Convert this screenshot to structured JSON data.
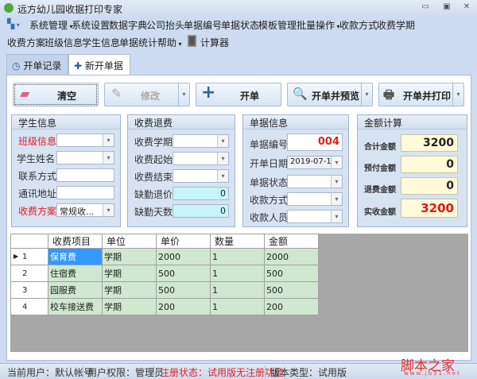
{
  "window": {
    "title": "远方幼儿园收据打印专家",
    "minimize": "▭",
    "restore": "▣",
    "close": "✕"
  },
  "menu": {
    "row1": [
      "系统管理",
      "系统设置",
      "数据字典",
      "公司抬头",
      "单据编号",
      "单据状态",
      "模板管理",
      "批量操作",
      "收款方式",
      "收费学期"
    ],
    "row2": [
      "收费方案",
      "班级信息",
      "学生信息",
      "单据统计",
      "帮助",
      "计算器"
    ]
  },
  "tabs": [
    {
      "label": "开单记录",
      "icon": "history-icon"
    },
    {
      "label": "新开单据",
      "icon": "plus-icon",
      "active": true
    }
  ],
  "toolbar": {
    "clear": "清空",
    "edit": "修改",
    "open": "开单",
    "open_preview": "开单并预览",
    "open_print": "开单并打印"
  },
  "student": {
    "title": "学生信息",
    "class_label": "班级信息",
    "class_value": "",
    "name_label": "学生姓名",
    "name_value": "",
    "contact_label": "联系方式",
    "contact_value": "",
    "address_label": "通讯地址",
    "address_value": "",
    "plan_label": "收费方案",
    "plan_value": "常规收..."
  },
  "fees": {
    "title": "收费退费",
    "term_label": "收费学期",
    "start_label": "收费起始",
    "end_label": "收费结束",
    "refund_price_label": "缺勤退价",
    "refund_price": "0",
    "absent_days_label": "缺勤天数",
    "absent_days": "0"
  },
  "receipt": {
    "title": "单据信息",
    "number_label": "单据编号",
    "number": "004",
    "date_label": "开单日期",
    "date": "2019-07-10",
    "status_label": "单据状态",
    "payment_label": "收款方式",
    "payee_label": "收款人员"
  },
  "amount": {
    "title": "金额计算",
    "total_label": "合计金额",
    "total": "3200",
    "prepaid_label": "预付金额",
    "prepaid": "0",
    "refund_label": "退费金额",
    "refund": "0",
    "received_label": "实收金额",
    "received": "3200"
  },
  "grid": {
    "columns": [
      "收费项目",
      "单位",
      "单价",
      "数量",
      "金额"
    ],
    "rows": [
      [
        "保育费",
        "学期",
        "2000",
        "1",
        "2000"
      ],
      [
        "住宿费",
        "学期",
        "500",
        "1",
        "500"
      ],
      [
        "园服费",
        "学期",
        "500",
        "1",
        "500"
      ],
      [
        "校车接送费",
        "学期",
        "200",
        "1",
        "200"
      ]
    ],
    "row_numbers": [
      "1",
      "2",
      "3",
      "4"
    ]
  },
  "status": {
    "user": "当前用户：默认帐号",
    "perm": "用户权限：管理员",
    "reg": "注册状态：试用版无注册功能",
    "ver": "版本类型：试用版"
  },
  "watermark": {
    "text": "脚本之家",
    "url": "www.jb51.net"
  },
  "colors": {
    "required": "#e02020",
    "selected": "#3399ff",
    "grid_cell": "#cfe8cf"
  }
}
